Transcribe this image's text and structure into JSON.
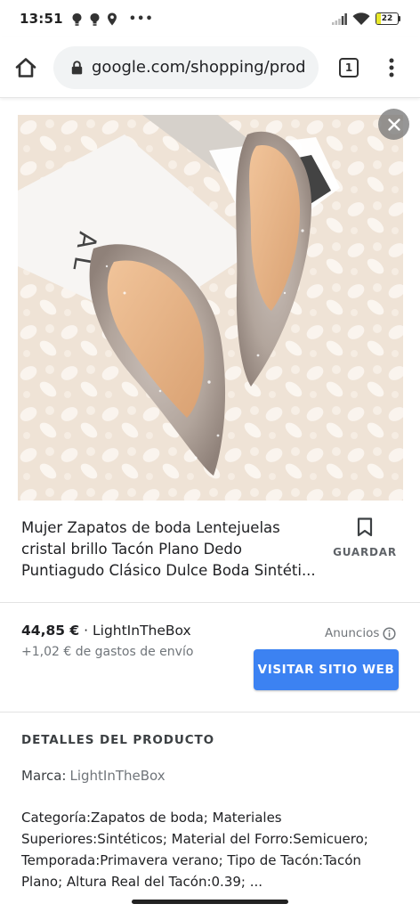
{
  "status_bar": {
    "time": "13:51",
    "more": "•••",
    "battery_level": "22",
    "battery_fraction": 0.22,
    "battery_color": "#e8e82a"
  },
  "browser": {
    "url": "google.com/shopping/prod",
    "tab_count": "1"
  },
  "product": {
    "title": "Mujer Zapatos de boda Lentejuelas cristal brillo Tacón Plano Dedo Puntiagudo Clásico Dulce Boda Sintéti...",
    "save_label": "GUARDAR",
    "price": "44,85 €",
    "separator": " · ",
    "seller": "LightInTheBox",
    "shipping": "+1,02 € de gastos de envío",
    "ads_label": "Anuncios",
    "visit_label": "VISITAR SITIO WEB",
    "accent_color": "#3c82f2"
  },
  "details": {
    "heading": "DETALLES DEL PRODUCTO",
    "brand_key": "Marca:",
    "brand_value": "LightInTheBox",
    "description": "Categoría:Zapatos de boda; Materiales Superiores:Sintéticos; Material del Forro:Semicuero; Temporada:Primavera verano; Tipo de Tacón:Tacón Plano; Altura Real del Tacón:0.39; ..."
  }
}
